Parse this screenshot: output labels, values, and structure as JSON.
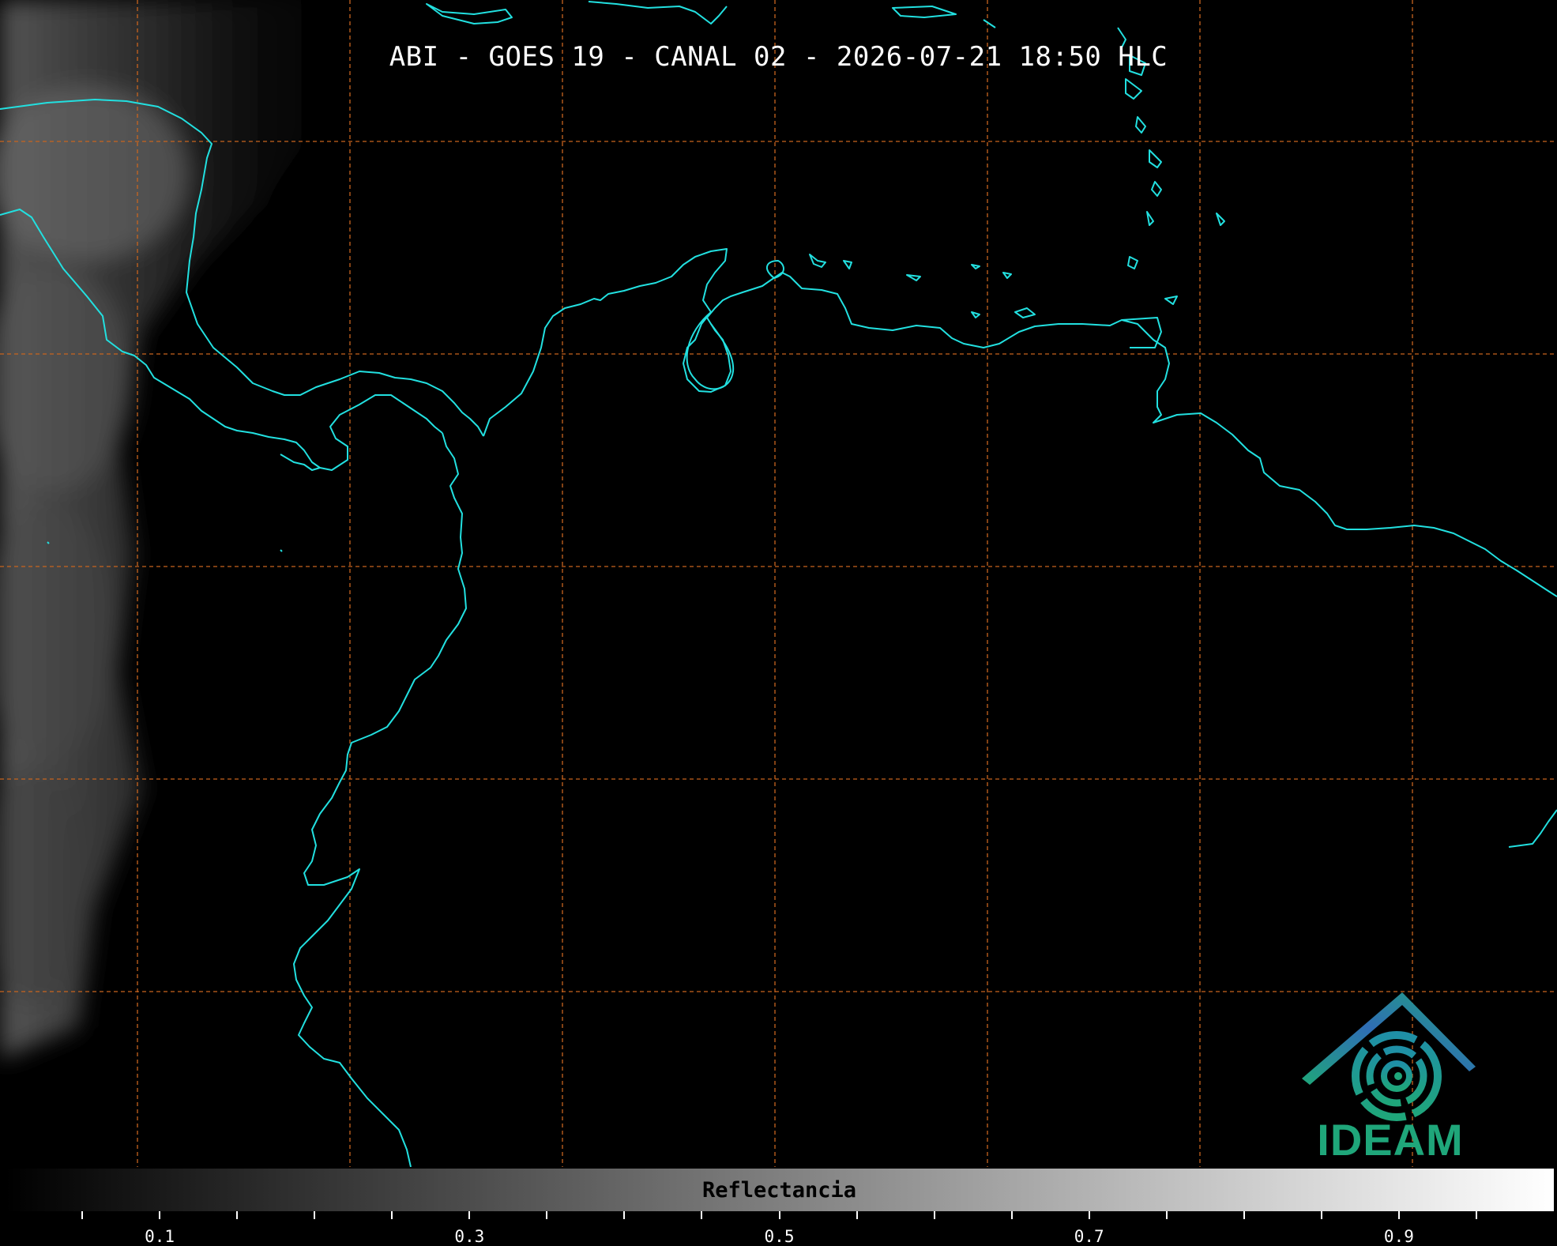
{
  "title": "ABI - GOES 19 - CANAL 02 - 2026-07-21 18:50 HLC",
  "colorbar": {
    "label": "Reflectancia",
    "ticks": [
      "0.1",
      "0.3",
      "0.5",
      "0.7",
      "0.9"
    ],
    "range": [
      0,
      1
    ],
    "colors": {
      "low": "#000000",
      "high": "#ffffff"
    }
  },
  "map": {
    "coastline_color": "#22e0e0",
    "grid_color": "#c8641e",
    "grid_style": "dashed",
    "background": "#000000"
  },
  "logo": {
    "text": "IDEAM",
    "colors": {
      "roof": "#2f6db5",
      "swirl": "#1fa67a",
      "text": "#1fa67a"
    }
  }
}
